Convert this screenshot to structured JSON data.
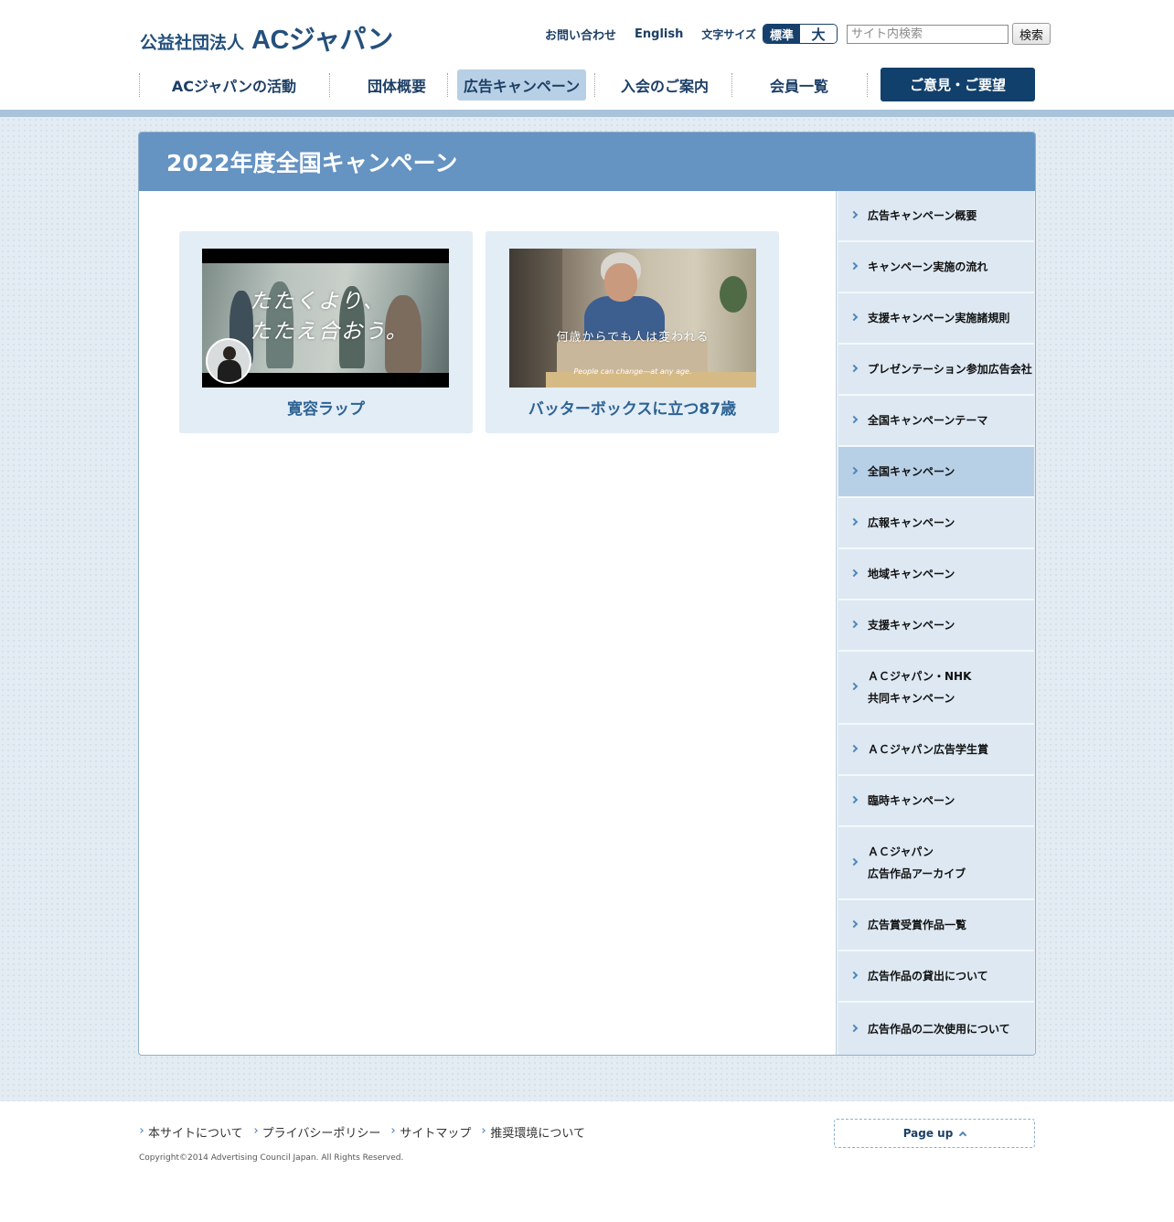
{
  "header": {
    "logo_small": "公益社団法人",
    "logo_big": "ACジャパン",
    "links": [
      "お問い合わせ",
      "English"
    ],
    "font_size_label": "文字サイズ",
    "font_size_standard": "標準",
    "font_size_large": "大",
    "search_placeholder": "サイト内検索",
    "search_button": "検索"
  },
  "gnav": {
    "items": [
      {
        "label": "ACジャパンの活動"
      },
      {
        "label": "団体概要"
      },
      {
        "label": "広告キャンペーン",
        "active": true
      },
      {
        "label": "入会のご案内"
      },
      {
        "label": "会員一覧"
      }
    ],
    "cta": "ご意見・ご要望"
  },
  "page": {
    "title": "2022年度全国キャンペーン",
    "cards": [
      {
        "title": "寛容ラップ",
        "thumb_caption": "たたくより、\nたたえ合おう。"
      },
      {
        "title": "バッターボックスに立つ87歳",
        "thumb_caption": "何歳からでも人は変われる",
        "thumb_subcaption": "People can change—at any age."
      }
    ]
  },
  "side_nav": {
    "items": [
      {
        "label": "広告キャンペーン概要"
      },
      {
        "label": "キャンペーン実施の流れ"
      },
      {
        "label": "支援キャンペーン実施諸規則"
      },
      {
        "label": "プレゼンテーション参加広告会社"
      },
      {
        "label": "全国キャンペーンテーマ"
      },
      {
        "label": "全国キャンペーン",
        "active": true
      },
      {
        "label": "広報キャンペーン"
      },
      {
        "label": "地域キャンペーン"
      },
      {
        "label": "支援キャンペーン"
      },
      {
        "label": "ＡＣジャパン・NHK\n共同キャンペーン"
      },
      {
        "label": "ＡＣジャパン広告学生賞"
      },
      {
        "label": "臨時キャンペーン"
      },
      {
        "label": "ＡＣジャパン\n広告作品アーカイブ"
      },
      {
        "label": "広告賞受賞作品一覧"
      },
      {
        "label": "広告作品の貸出について"
      },
      {
        "label": "広告作品の二次使用について"
      }
    ]
  },
  "footer": {
    "links": [
      "本サイトについて",
      "プライバシーポリシー",
      "サイトマップ",
      "推奨環境について"
    ],
    "copyright": "Copyright©2014 Advertising Council Japan. All Rights Reserved.",
    "pageup": "Page up"
  },
  "colors": {
    "brand_navy": "#12406c",
    "title_bar": "#6593c2",
    "active_highlight": "#b8d0e6",
    "card_bg": "#e3edf6",
    "card_title": "#2d6394"
  }
}
